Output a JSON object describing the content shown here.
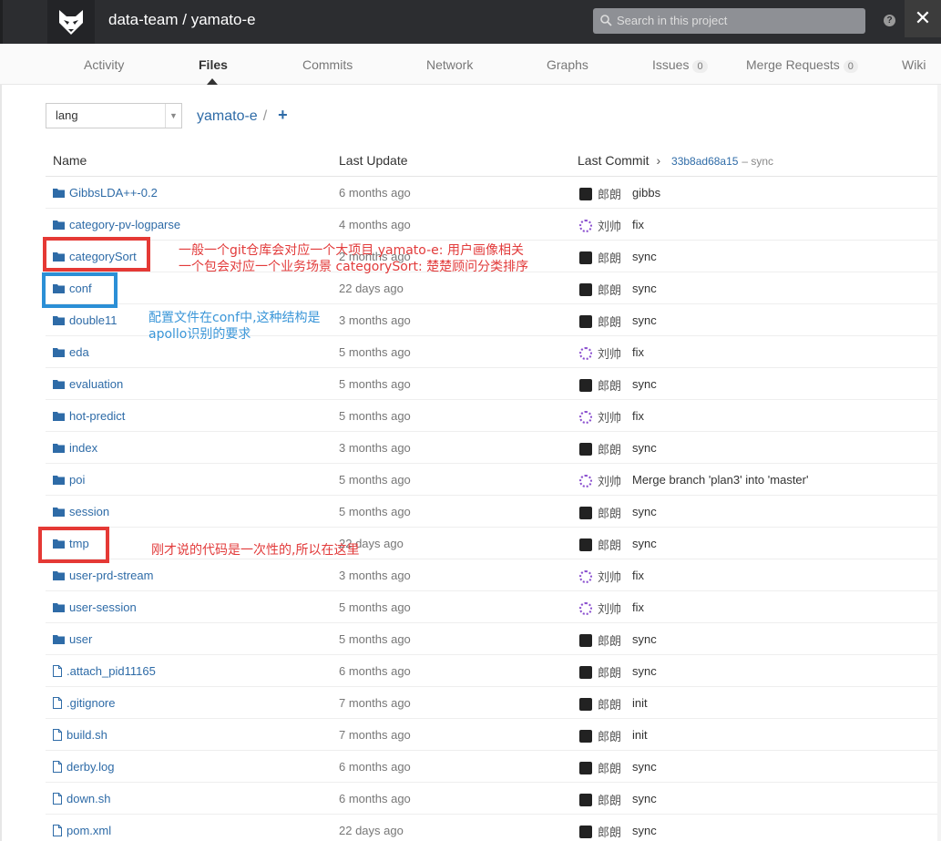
{
  "header": {
    "project_title": "data-team / yamato-e",
    "search_placeholder": "Search in this project",
    "help_label": "?",
    "close_label": "✕"
  },
  "nav": {
    "tabs": [
      {
        "label": "Activity"
      },
      {
        "label": "Files",
        "active": true
      },
      {
        "label": "Commits"
      },
      {
        "label": "Network"
      },
      {
        "label": "Graphs"
      },
      {
        "label": "Issues",
        "count": "0"
      },
      {
        "label": "Merge Requests",
        "count": "0"
      },
      {
        "label": "Wiki"
      }
    ]
  },
  "toolbar": {
    "branch": "lang",
    "repo_crumb": "yamato-e",
    "separator": "/",
    "add_label": "+"
  },
  "table": {
    "headers": {
      "name": "Name",
      "last_update": "Last Update",
      "last_commit": "Last Commit",
      "commit_hash": "33b8ad68a15",
      "commit_msg": "– sync"
    },
    "rows": [
      {
        "name": "GibbsLDA++-0.2",
        "type": "folder",
        "date": "6 months ago",
        "author": "郎朗",
        "avatar": "dark",
        "msg": "gibbs"
      },
      {
        "name": "category-pv-logparse",
        "type": "folder",
        "date": "4 months ago",
        "author": "刘帅",
        "avatar": "purple",
        "msg": "fix"
      },
      {
        "name": "categorySort",
        "type": "folder",
        "date": "2 months ago",
        "author": "郎朗",
        "avatar": "dark",
        "msg": "sync"
      },
      {
        "name": "conf",
        "type": "folder",
        "date": "22 days ago",
        "author": "郎朗",
        "avatar": "dark",
        "msg": "sync"
      },
      {
        "name": "double11",
        "type": "folder",
        "date": "3 months ago",
        "author": "郎朗",
        "avatar": "dark",
        "msg": "sync"
      },
      {
        "name": "eda",
        "type": "folder",
        "date": "5 months ago",
        "author": "刘帅",
        "avatar": "purple",
        "msg": "fix"
      },
      {
        "name": "evaluation",
        "type": "folder",
        "date": "5 months ago",
        "author": "郎朗",
        "avatar": "dark",
        "msg": "sync"
      },
      {
        "name": "hot-predict",
        "type": "folder",
        "date": "5 months ago",
        "author": "刘帅",
        "avatar": "purple",
        "msg": "fix"
      },
      {
        "name": "index",
        "type": "folder",
        "date": "3 months ago",
        "author": "郎朗",
        "avatar": "dark",
        "msg": "sync"
      },
      {
        "name": "poi",
        "type": "folder",
        "date": "5 months ago",
        "author": "刘帅",
        "avatar": "purple",
        "msg": "Merge branch 'plan3' into 'master'"
      },
      {
        "name": "session",
        "type": "folder",
        "date": "5 months ago",
        "author": "郎朗",
        "avatar": "dark",
        "msg": "sync"
      },
      {
        "name": "tmp",
        "type": "folder",
        "date": "22 days ago",
        "author": "郎朗",
        "avatar": "dark",
        "msg": "sync"
      },
      {
        "name": "user-prd-stream",
        "type": "folder",
        "date": "3 months ago",
        "author": "刘帅",
        "avatar": "purple",
        "msg": "fix"
      },
      {
        "name": "user-session",
        "type": "folder",
        "date": "5 months ago",
        "author": "刘帅",
        "avatar": "purple",
        "msg": "fix"
      },
      {
        "name": "user",
        "type": "folder",
        "date": "5 months ago",
        "author": "郎朗",
        "avatar": "dark",
        "msg": "sync"
      },
      {
        "name": ".attach_pid11165",
        "type": "file",
        "date": "6 months ago",
        "author": "郎朗",
        "avatar": "dark",
        "msg": "sync"
      },
      {
        "name": ".gitignore",
        "type": "file",
        "date": "7 months ago",
        "author": "郎朗",
        "avatar": "dark",
        "msg": "init"
      },
      {
        "name": "build.sh",
        "type": "file",
        "date": "7 months ago",
        "author": "郎朗",
        "avatar": "dark",
        "msg": "init"
      },
      {
        "name": "derby.log",
        "type": "file",
        "date": "6 months ago",
        "author": "郎朗",
        "avatar": "dark",
        "msg": "sync"
      },
      {
        "name": "down.sh",
        "type": "file",
        "date": "6 months ago",
        "author": "郎朗",
        "avatar": "dark",
        "msg": "sync"
      },
      {
        "name": "pom.xml",
        "type": "file",
        "date": "22 days ago",
        "author": "郎朗",
        "avatar": "dark",
        "msg": "sync"
      }
    ]
  },
  "annotations": {
    "note1_line1": "一般一个git仓库会对应一个大项目  yamato-e: 用户画像相关",
    "note1_line2": "一个包会对应一个业务场景 categorySort: 楚楚顾问分类排序",
    "note2_line1": "配置文件在conf中,这种结构是",
    "note2_line2": "apollo识别的要求",
    "note3": "刚才说的代码是一次性的,所以在这里"
  },
  "colors": {
    "link": "#2e6ba7",
    "annotation_red": "#e23b3b",
    "annotation_blue": "#3a96d8"
  }
}
